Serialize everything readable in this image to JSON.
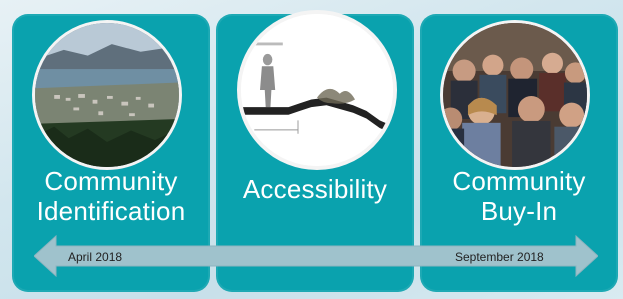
{
  "stages": [
    {
      "label_line1": "Community",
      "label_line2": "Identification",
      "image": "aerial-town-photo"
    },
    {
      "label": "Accessibility",
      "image": "elevation-profile-sketch"
    },
    {
      "label_line1": "Community",
      "label_line2": "Buy-In",
      "image": "community-meeting-photo"
    }
  ],
  "timeline": {
    "start_label": "April 2018",
    "end_label": "September 2018"
  },
  "colors": {
    "panel": "#0aa2ae",
    "arrow": "#9fc2cc",
    "text": "#ffffff"
  }
}
